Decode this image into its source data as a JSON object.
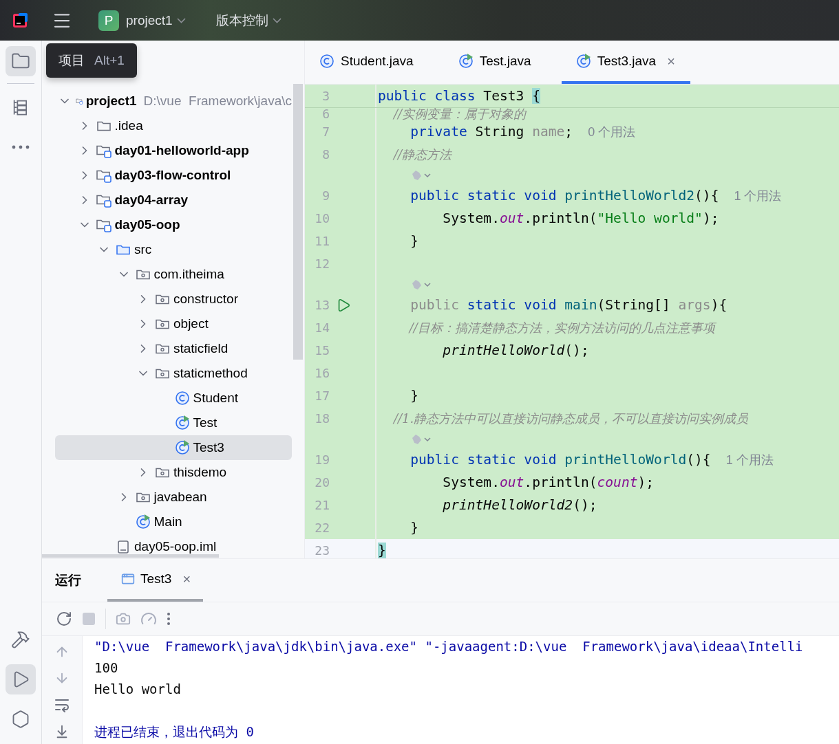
{
  "top_bar": {
    "project_badge": "P",
    "project": "project1",
    "vcs": "版本控制"
  },
  "tool_strip": {
    "top": [
      {
        "kind": "folder",
        "selected": true
      },
      {
        "kind": "structure",
        "selected": false
      },
      {
        "kind": "more",
        "selected": false
      }
    ],
    "bottom": [
      {
        "kind": "build",
        "selected": false
      },
      {
        "kind": "run",
        "selected": true
      },
      {
        "kind": "services",
        "selected": false
      }
    ]
  },
  "tooltip": {
    "label": "项目",
    "shortcut": "Alt+1"
  },
  "project_tree": [
    {
      "label": "project1",
      "kind": "module",
      "hint": "D:\\vue  Framework\\java\\c",
      "expanded": true,
      "selected": false,
      "children": [
        {
          "label": ".idea",
          "kind": "folder",
          "expanded": false,
          "selected": false
        },
        {
          "label": "day01-helloworld-app",
          "kind": "module",
          "expanded": false,
          "selected": false
        },
        {
          "label": "day03-flow-control",
          "kind": "module",
          "expanded": false,
          "selected": false
        },
        {
          "label": "day04-array",
          "kind": "module",
          "expanded": false,
          "selected": false
        },
        {
          "label": "day05-oop",
          "kind": "module",
          "expanded": true,
          "selected": false,
          "children": [
            {
              "label": "src",
              "kind": "source",
              "expanded": true,
              "selected": false,
              "children": [
                {
                  "label": "com.itheima",
                  "kind": "package",
                  "expanded": true,
                  "selected": false,
                  "children": [
                    {
                      "label": "constructor",
                      "kind": "package",
                      "expanded": false,
                      "selected": false
                    },
                    {
                      "label": "object",
                      "kind": "package",
                      "expanded": false,
                      "selected": false
                    },
                    {
                      "label": "staticfield",
                      "kind": "package",
                      "expanded": false,
                      "selected": false
                    },
                    {
                      "label": "staticmethod",
                      "kind": "package",
                      "expanded": true,
                      "selected": false,
                      "children": [
                        {
                          "label": "Student",
                          "kind": "class",
                          "selected": false
                        },
                        {
                          "label": "Test",
                          "kind": "runnable",
                          "selected": false
                        },
                        {
                          "label": "Test3",
                          "kind": "runnable",
                          "selected": true
                        }
                      ]
                    },
                    {
                      "label": "thisdemo",
                      "kind": "package",
                      "expanded": false,
                      "selected": false
                    }
                  ]
                },
                {
                  "label": "javabean",
                  "kind": "package",
                  "expanded": false,
                  "selected": false
                },
                {
                  "label": "Main",
                  "kind": "runnable",
                  "selected": false
                }
              ]
            },
            {
              "label": "day05-oop.iml",
              "kind": "file",
              "selected": false
            }
          ]
        }
      ]
    }
  ],
  "editor_tabs": [
    {
      "label": "Student.java",
      "kind": "class",
      "selected": false
    },
    {
      "label": "Test.java",
      "kind": "runnable",
      "selected": false
    },
    {
      "label": "Test3.java",
      "kind": "runnable",
      "selected": true,
      "close": "×"
    }
  ],
  "code": {
    "sticky": {
      "number": "3",
      "tokens": [
        {
          "kind": "keyword",
          "text": "public class"
        },
        {
          "kind": "plain",
          "text": " Test3 "
        },
        {
          "kind": "brace",
          "text": "{"
        }
      ]
    },
    "lines": [
      {
        "number": "6",
        "cut": true,
        "tokens": [
          {
            "kind": "comment",
            "text": "    //实例变量：属于对象的"
          }
        ]
      },
      {
        "number": "7",
        "tokens": [
          {
            "kind": "keyword",
            "text": "    private"
          },
          {
            "kind": "plain",
            "text": " String "
          },
          {
            "kind": "param",
            "text": "name"
          },
          {
            "kind": "plain",
            "text": ";"
          },
          {
            "kind": "hint",
            "text": "0 个用法"
          }
        ]
      },
      {
        "number": "8",
        "tokens": [
          {
            "kind": "comment",
            "text": "    //静态方法"
          }
        ]
      },
      {
        "number": "9",
        "lens": true,
        "tokens": [
          {
            "kind": "keyword",
            "text": "    public static void"
          },
          {
            "kind": "method",
            "text": " printHelloWorld2"
          },
          {
            "kind": "plain",
            "text": "(){"
          },
          {
            "kind": "hint",
            "text": "1 个用法"
          }
        ]
      },
      {
        "number": "10",
        "tokens": [
          {
            "kind": "plain",
            "text": "        System."
          },
          {
            "kind": "field",
            "text": "out"
          },
          {
            "kind": "plain",
            "text": ".println("
          },
          {
            "kind": "string",
            "text": "\"Hello world\""
          },
          {
            "kind": "plain",
            "text": ");"
          }
        ]
      },
      {
        "number": "11",
        "tokens": [
          {
            "kind": "plain",
            "text": "    }"
          }
        ]
      },
      {
        "number": "12"
      },
      {
        "number": "13",
        "lens": true,
        "run": true,
        "tokens": [
          {
            "kind": "param",
            "text": "    public"
          },
          {
            "kind": "keyword",
            "text": " static void"
          },
          {
            "kind": "method",
            "text": " main"
          },
          {
            "kind": "plain",
            "text": "(String[] "
          },
          {
            "kind": "param",
            "text": "args"
          },
          {
            "kind": "plain",
            "text": "){"
          }
        ]
      },
      {
        "number": "14",
        "tokens": [
          {
            "kind": "comment",
            "text": "        //目标：搞清楚静态方法，实例方法访问的几点注意事项"
          }
        ]
      },
      {
        "number": "15",
        "tokens": [
          {
            "kind": "call",
            "text": "        printHelloWorld"
          },
          {
            "kind": "plain",
            "text": "();"
          }
        ]
      },
      {
        "number": "16"
      },
      {
        "number": "17",
        "tokens": [
          {
            "kind": "plain",
            "text": "    }"
          }
        ]
      },
      {
        "number": "18",
        "tokens": [
          {
            "kind": "comment",
            "text": "    //1.静态方法中可以直接访问静态成员，不可以直接访问实例成员"
          }
        ]
      },
      {
        "number": "19",
        "lens": true,
        "tokens": [
          {
            "kind": "keyword",
            "text": "    public static void"
          },
          {
            "kind": "method",
            "text": " printHelloWorld"
          },
          {
            "kind": "plain",
            "text": "(){"
          },
          {
            "kind": "hint",
            "text": "1 个用法"
          }
        ]
      },
      {
        "number": "20",
        "tokens": [
          {
            "kind": "plain",
            "text": "        System."
          },
          {
            "kind": "field",
            "text": "out"
          },
          {
            "kind": "plain",
            "text": ".println("
          },
          {
            "kind": "field",
            "text": "count"
          },
          {
            "kind": "plain",
            "text": ");"
          }
        ]
      },
      {
        "number": "21",
        "tokens": [
          {
            "kind": "call",
            "text": "        printHelloWorld2"
          },
          {
            "kind": "plain",
            "text": "();"
          }
        ]
      },
      {
        "number": "22",
        "tokens": [
          {
            "kind": "plain",
            "text": "    }"
          }
        ]
      },
      {
        "number": "23",
        "current": true,
        "tokens": [
          {
            "kind": "brace",
            "text": "}"
          }
        ]
      }
    ]
  },
  "run_panel": {
    "title": "运行",
    "tabs": [
      {
        "label": "Test3",
        "selected": true,
        "close": "×"
      }
    ],
    "console": [
      {
        "kind": "system",
        "text": "\"D:\\vue  Framework\\java\\jdk\\bin\\java.exe\" \"-javaagent:D:\\vue  Framework\\java\\ideaa\\Intelli"
      },
      {
        "kind": "output",
        "text": "100"
      },
      {
        "kind": "output",
        "text": "Hello world"
      },
      {
        "kind": "blank"
      },
      {
        "kind": "system",
        "text": "进程已结束，退出代码为 0"
      }
    ]
  }
}
